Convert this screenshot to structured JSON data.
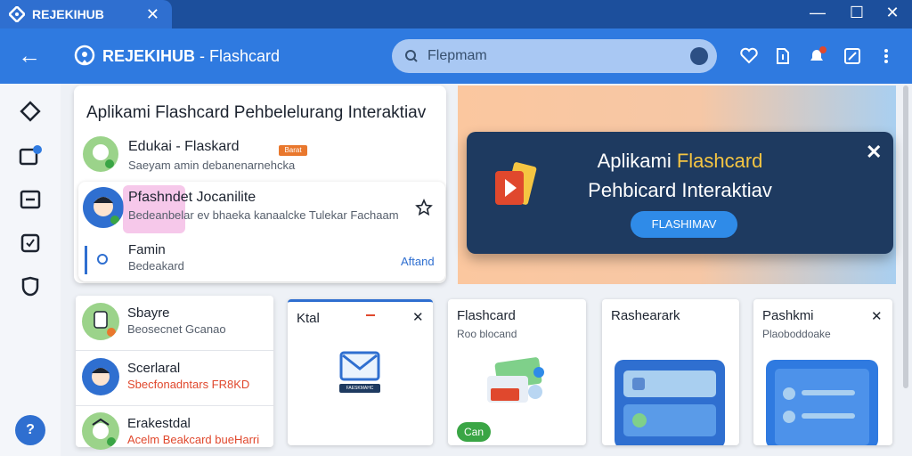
{
  "window": {
    "tab_title": "REJEKIHUB",
    "tab_close": "✕",
    "minimize": "—",
    "maximize": "☐",
    "close": "✕"
  },
  "appbar": {
    "back": "←",
    "title_brand": "REJEKIHUB",
    "title_rest": " - Flashcard",
    "search_placeholder": "Flepmam"
  },
  "help": "?",
  "featured": {
    "heading": "Aplikami Flashcard Pehbelelurang Interaktiav",
    "items": [
      {
        "title": "Edukai - Flaskard",
        "subtitle": "Saeyam amin debanenarnehcka",
        "badge": "Barat"
      },
      {
        "title": "Pfashndet Jocanilite",
        "subtitle": "Bedeanbelar ev bhaeka kanaalcke Tulekar Fachaam"
      },
      {
        "title": "Famin",
        "subtitle": "Bedeakard",
        "action": "Aftand"
      }
    ]
  },
  "banner": {
    "line1_white": "Aplikami ",
    "line1_yellow": "Flashcard",
    "line2": "Pehbicard Interaktiav",
    "button": "FLASHIMAV",
    "close": "✕"
  },
  "sidelist": [
    {
      "title": "Sbayre",
      "subtitle": "Beosecnet Gcanao"
    },
    {
      "title": "Scerlaral",
      "subtitle": "Sbecfonadntars FR8KD"
    },
    {
      "title": "Erakestdal",
      "subtitle": "Acelm Beakcard bueHarri"
    }
  ],
  "cards": [
    {
      "title": "Ktal",
      "close": "✕",
      "caption": "FAESKMAHC"
    },
    {
      "title": "Flashcard",
      "subtitle": "Roo blocand",
      "pill": "Can"
    },
    {
      "title": "Rashearark"
    },
    {
      "title": "Pashkmi",
      "subtitle": "Plaoboddoake",
      "close": "✕"
    }
  ],
  "colors": {
    "accent": "#2f7ae0",
    "titlebar": "#1c4f9c",
    "banner": "#1e3a60",
    "highlight": "#f5c542",
    "warning": "#e0482d"
  }
}
